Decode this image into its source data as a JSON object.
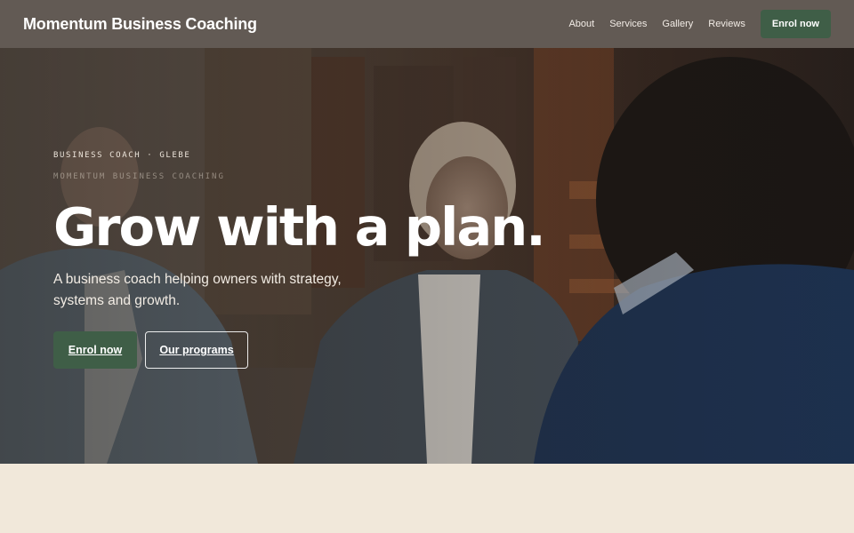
{
  "header": {
    "brand": "Momentum Business Coaching",
    "nav": [
      "About",
      "Services",
      "Gallery",
      "Reviews"
    ],
    "cta": "Enrol now"
  },
  "hero": {
    "eyebrow": "BUSINESS COACH · GLEBE",
    "eyebrow_secondary": "MOMENTUM BUSINESS COACHING",
    "headline": "Grow with a plan.",
    "subheadline": "A business coach helping owners with strategy, systems and growth.",
    "primary_button": "Enrol now",
    "secondary_button": "Our programs"
  },
  "colors": {
    "header_bg": "#625a54",
    "accent_green": "#3f5e47",
    "page_bg": "#f1e8da"
  }
}
